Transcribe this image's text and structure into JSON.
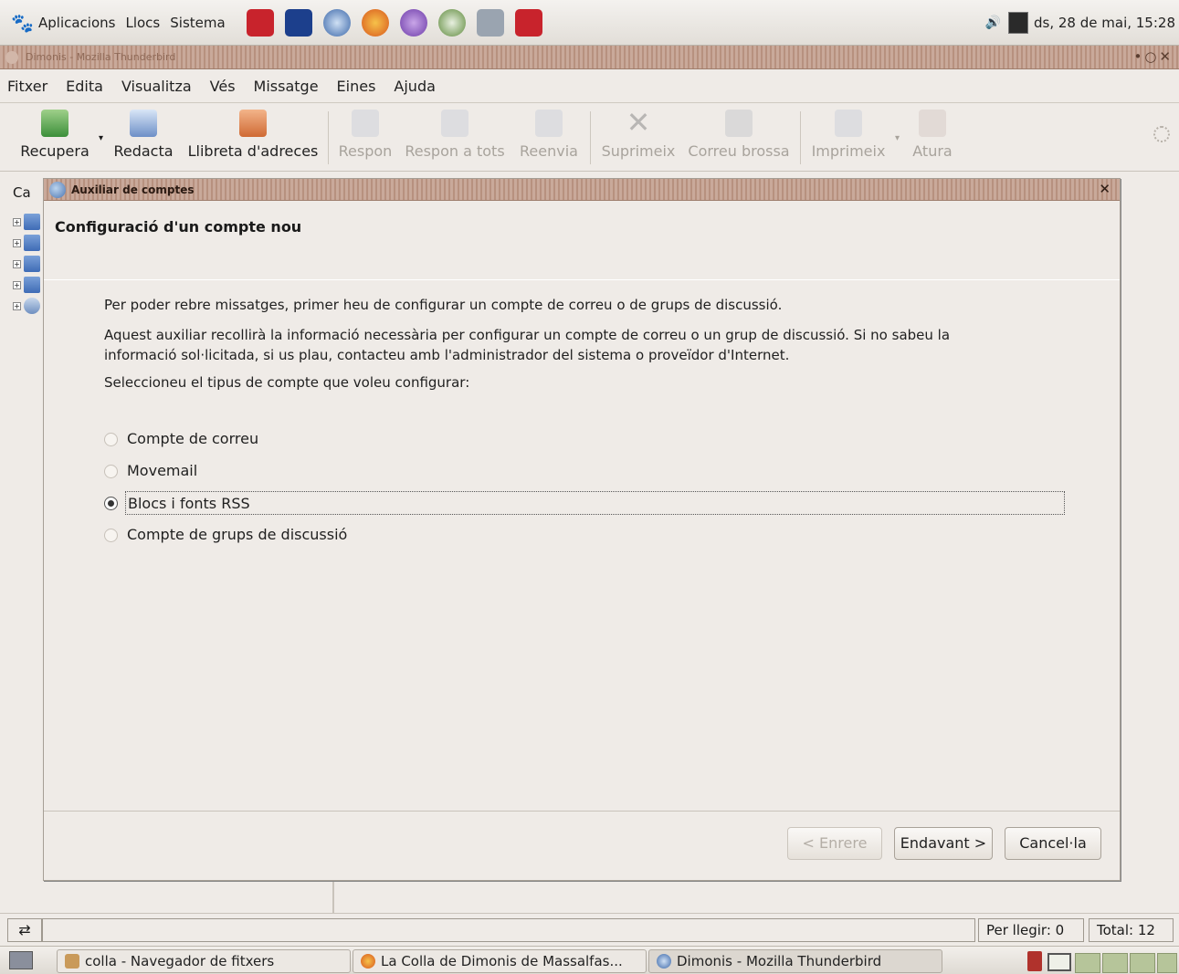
{
  "top_panel": {
    "menus": [
      "Aplicacions",
      "Llocs",
      "Sistema"
    ],
    "launcher_icons": [
      "phone-icon",
      "terminal-icon",
      "thunderbird-icon",
      "firefox-icon",
      "pidgin-icon",
      "update-icon",
      "search-icon",
      "presentation-icon"
    ],
    "clock": "ds, 28 de mai, 15:28"
  },
  "window": {
    "title": "Dimonis - Mozilla Thunderbird"
  },
  "menubar": [
    "Fitxer",
    "Edita",
    "Visualitza",
    "Vés",
    "Missatge",
    "Eines",
    "Ajuda"
  ],
  "toolbar": {
    "get_mail": "Recupera",
    "compose": "Redacta",
    "address_book": "Llibreta d'adreces",
    "reply": "Respon",
    "reply_all": "Respon a tots",
    "forward": "Reenvia",
    "delete": "Suprimeix",
    "junk": "Correu brossa",
    "print": "Imprimeix",
    "stop": "Atura"
  },
  "folder_pane": {
    "header": "Ca"
  },
  "dialog": {
    "title": "Auxiliar de comptes",
    "heading": "Configuració d'un compte nou",
    "para1": "Per poder rebre missatges, primer heu de configurar un compte de correu o de grups de discussió.",
    "para2_line1": "Aquest auxiliar recollirà la informació necessària per configurar un compte de correu o un grup de discussió. Si no sabeu la",
    "para2_line2": "informació sol·licitada, si us plau, contacteu amb l'administrador del sistema o proveïdor d'Internet.",
    "para3": "Seleccioneu el tipus de compte que voleu configurar:",
    "options": [
      {
        "label": "Compte de correu",
        "selected": false
      },
      {
        "label": "Movemail",
        "selected": false
      },
      {
        "label": "Blocs i fonts RSS",
        "selected": true
      },
      {
        "label": "Compte de grups de discussió",
        "selected": false
      }
    ],
    "back_button": "< Enrere",
    "next_button": "Endavant >",
    "cancel_button": "Cancel·la"
  },
  "statusbar": {
    "unread": "Per llegir: 0",
    "total": "Total: 12"
  },
  "taskbar": {
    "tasks": [
      "colla - Navegador de fitxers",
      "La Colla de Dimonis de Massalfas...",
      "Dimonis - Mozilla Thunderbird"
    ]
  }
}
